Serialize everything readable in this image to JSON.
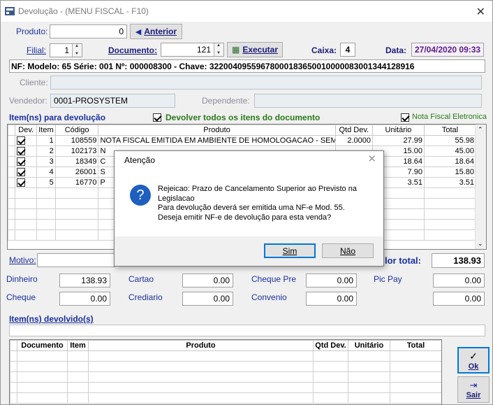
{
  "window": {
    "title": "Devolução - (MENU FISCAL - F10)"
  },
  "produto": {
    "label": "Produto:",
    "value": "0",
    "anterior_label": "Anterior"
  },
  "filial": {
    "label": "Filial:",
    "value": "1"
  },
  "documento": {
    "label": "Documento:",
    "value": "121",
    "executar_label": "Executar"
  },
  "caixa": {
    "label": "Caixa:",
    "value": "4"
  },
  "data": {
    "label": "Data:",
    "value": "27/04/2020 09:33"
  },
  "nf_line": "NF: Modelo: 65 Série: 001 Nº: 000008300 - Chave: 32200409559678000183650010000083001344128916",
  "cliente": {
    "label": "Cliente:",
    "value": ""
  },
  "vendedor": {
    "label": "Vendedor:",
    "value": "0001-PROSYSTEM"
  },
  "dependente": {
    "label": "Dependente:",
    "value": ""
  },
  "itens_section": {
    "title": "Item(ns) para devolução",
    "devolver_todos_label": "Devolver todos os itens do documento",
    "nota_fiscal_label": "Nota Fiscal Eletronica"
  },
  "items_table": {
    "headers": [
      "Dev.",
      "Item",
      "Código",
      "Produto",
      "Qtd Dev.",
      "Unitário",
      "Total"
    ],
    "rows": [
      {
        "dev": true,
        "item": "1",
        "codigo": "108559",
        "produto": "NOTA FISCAL EMITIDA EM AMBIENTE DE HOMOLOGACAO - SEM VA",
        "qtd": "2.0000",
        "unitario": "27.99",
        "total": "55.98"
      },
      {
        "dev": true,
        "item": "2",
        "codigo": "102173",
        "produto": "N",
        "qtd": "",
        "unitario": "15.00",
        "total": "45.00"
      },
      {
        "dev": true,
        "item": "3",
        "codigo": "18349",
        "produto": "C",
        "qtd": "",
        "unitario": "18.64",
        "total": "18.64"
      },
      {
        "dev": true,
        "item": "4",
        "codigo": "26001",
        "produto": "S",
        "qtd": "",
        "unitario": "7.90",
        "total": "15.80"
      },
      {
        "dev": true,
        "item": "5",
        "codigo": "16770",
        "produto": "P",
        "qtd": "",
        "unitario": "3.51",
        "total": "3.51"
      }
    ]
  },
  "motivo": {
    "label": "Motivo:",
    "value": ""
  },
  "valor_total": {
    "label": "lor total:",
    "value": "138.93"
  },
  "payments": {
    "dinheiro": {
      "label": "Dinheiro",
      "value": "138.93"
    },
    "cartao": {
      "label": "Cartao",
      "value": "0.00"
    },
    "cheque_pre": {
      "label": "Cheque Pre",
      "value": "0.00"
    },
    "pic_pay": {
      "label": "Pic Pay",
      "value": "0.00"
    },
    "cheque": {
      "label": "Cheque",
      "value": "0.00"
    },
    "crediario": {
      "label": "Crediario",
      "value": "0.00"
    },
    "convenio": {
      "label": "Convenio",
      "value": "0.00"
    },
    "extra": {
      "value": "0.00"
    }
  },
  "devolvidos_section": {
    "title": "Item(ns) devolvido(s)"
  },
  "devolvidos_table": {
    "headers": [
      "Documento",
      "Item",
      "Produto",
      "Qtd Dev.",
      "Unitário",
      "Total"
    ]
  },
  "ok_button": {
    "label": "Ok"
  },
  "sair_button": {
    "label": "Sair"
  },
  "dialog": {
    "title": "Atenção",
    "message_line1": "Rejeicao: Prazo de Cancelamento Superior ao Previsto na",
    "message_line2": "Legislacao",
    "message_line3": "Para devolução deverá ser emitida uma NF-e Mod. 55.",
    "message_line4": "Deseja emitir NF-e de devolução para esta venda?",
    "sim_label": "Sim",
    "nao_label": "Não"
  },
  "colors": {
    "accent": "#1b2f9e",
    "section_green": "#2a7a1a",
    "date_purple": "#5a1a8a"
  }
}
